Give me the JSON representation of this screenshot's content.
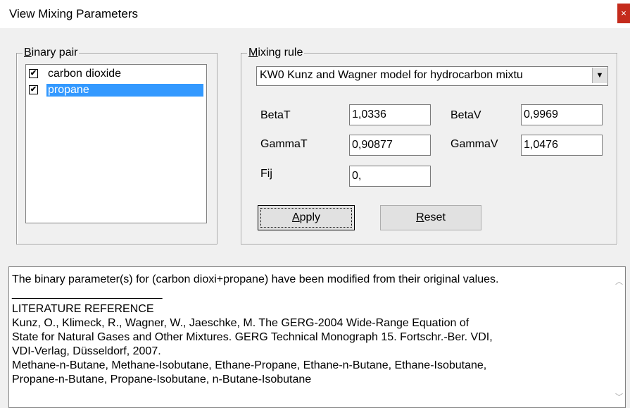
{
  "window": {
    "title": "View Mixing Parameters",
    "close_glyph": "×"
  },
  "binary_pair": {
    "legend": "Binary pair",
    "legend_accel": "B",
    "legend_rest": "inary pair",
    "items": [
      {
        "label": "carbon dioxide",
        "checked": true,
        "selected": false
      },
      {
        "label": "propane",
        "checked": true,
        "selected": true
      }
    ]
  },
  "mixing_rule": {
    "legend_accel": "M",
    "legend_rest": "ixing rule",
    "selected": "KW0  Kunz and Wagner model for hydrocarbon mixtu",
    "params": {
      "betaT": {
        "label": "BetaT",
        "value": "1,0336"
      },
      "betaV": {
        "label": "BetaV",
        "value": "0,9969"
      },
      "gammaT": {
        "label": "GammaT",
        "value": "0,90877"
      },
      "gammaV": {
        "label": "GammaV",
        "value": "1,0476"
      },
      "fij": {
        "label": "Fij",
        "value": "0,"
      }
    },
    "apply": {
      "accel": "A",
      "rest": "pply"
    },
    "reset": {
      "accel": "R",
      "rest": "eset"
    }
  },
  "info": {
    "lines": [
      "The binary parameter(s) for (carbon dioxi+propane) have been modified from their original values.",
      "________________________",
      "LITERATURE REFERENCE",
      "Kunz, O., Klimeck, R., Wagner, W., Jaeschke, M. The GERG-2004 Wide-Range Equation of",
      "State for Natural Gases and Other Mixtures. GERG Technical Monograph 15. Fortschr.-Ber. VDI,",
      "VDI-Verlag, Düsseldorf, 2007.",
      "Methane-n-Butane, Methane-Isobutane, Ethane-Propane, Ethane-n-Butane, Ethane-Isobutane,",
      "Propane-n-Butane, Propane-Isobutane, n-Butane-Isobutane"
    ]
  },
  "colors": {
    "selection": "#3399ff",
    "close": "#c42b1c",
    "window_bg": "#f0f0f0"
  }
}
